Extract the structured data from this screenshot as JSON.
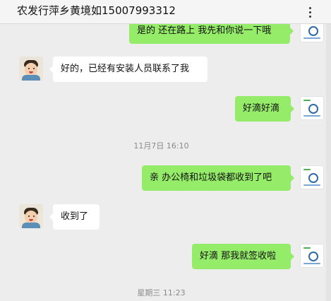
{
  "header": {
    "title": "农发行萍乡黄境如15007993312",
    "more_icon": "more-dots-icon"
  },
  "colors": {
    "outgoing_bubble": "#95ec69",
    "incoming_bubble": "#ffffff",
    "chat_background": "#ededed"
  },
  "messages": [
    {
      "side": "out",
      "text": "是的 还在路上 我先和你说一下哦"
    },
    {
      "side": "in",
      "text": "好的，已经有安装人员联系了我"
    },
    {
      "side": "out",
      "text": "好滴好滴"
    },
    {
      "side": "out",
      "text": "亲 办公椅和垃圾袋都收到了吧"
    },
    {
      "side": "in",
      "text": "收到了"
    },
    {
      "side": "out",
      "text": "好滴 那我就签收啦"
    }
  ],
  "timestamps": [
    "11月7日 16:10",
    "星期三 11:23"
  ]
}
